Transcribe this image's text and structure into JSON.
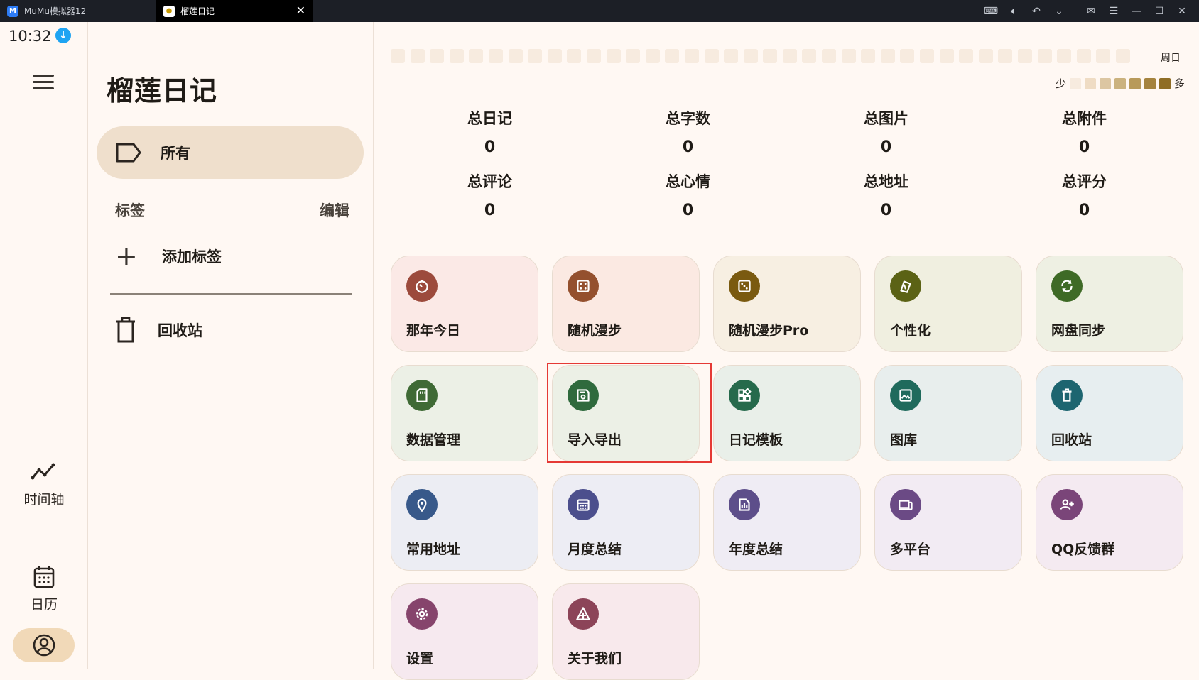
{
  "titlebar": {
    "tabs": [
      {
        "label": "MuMu模拟器12",
        "active": false
      },
      {
        "label": "榴莲日记",
        "active": true
      }
    ]
  },
  "status": {
    "time": "10:32"
  },
  "rail": {
    "items": [
      {
        "label": "时间轴"
      },
      {
        "label": "日历"
      }
    ]
  },
  "drawer": {
    "app_title": "榴莲日记",
    "all_label": "所有",
    "tags_label": "标签",
    "edit_label": "编辑",
    "add_tag_label": "添加标签",
    "trash_label": "回收站"
  },
  "heatmap": {
    "weekday_label": "周日",
    "legend_less": "少",
    "legend_more": "多",
    "legend_colors": [
      "#f7ebdf",
      "#efdcc4",
      "#dcc6a2",
      "#cbb27e",
      "#b89a5a",
      "#a5833e",
      "#8f6d25"
    ]
  },
  "stats": [
    {
      "label": "总日记",
      "value": "0"
    },
    {
      "label": "总字数",
      "value": "0"
    },
    {
      "label": "总图片",
      "value": "0"
    },
    {
      "label": "总附件",
      "value": "0"
    },
    {
      "label": "总评论",
      "value": "0"
    },
    {
      "label": "总心情",
      "value": "0"
    },
    {
      "label": "总地址",
      "value": "0"
    },
    {
      "label": "总评分",
      "value": "0"
    }
  ],
  "features": [
    {
      "label": "那年今日",
      "icon": "timer-icon",
      "bg": "#fbe9e6",
      "iconbg": "#9c4a3c"
    },
    {
      "label": "随机漫步",
      "icon": "dice-icon",
      "bg": "#fbe9e2",
      "iconbg": "#94502e"
    },
    {
      "label": "随机漫步Pro",
      "icon": "dice-pro-icon",
      "bg": "#f7efe2",
      "iconbg": "#7a5a10"
    },
    {
      "label": "个性化",
      "icon": "palette-icon",
      "bg": "#f0efe0",
      "iconbg": "#5b6215"
    },
    {
      "label": "网盘同步",
      "icon": "sync-icon",
      "bg": "#eef0e3",
      "iconbg": "#3e6a26"
    },
    {
      "label": "数据管理",
      "icon": "sd-card-icon",
      "bg": "#ecf0e6",
      "iconbg": "#3f6a35"
    },
    {
      "label": "导入导出",
      "icon": "save-icon",
      "bg": "#ecf0e6",
      "iconbg": "#2f6a3d"
    },
    {
      "label": "日记模板",
      "icon": "widgets-icon",
      "bg": "#e9efe9",
      "iconbg": "#266a4c"
    },
    {
      "label": "图库",
      "icon": "image-icon",
      "bg": "#e8eeed",
      "iconbg": "#1f6a5c"
    },
    {
      "label": "回收站",
      "icon": "trash-icon",
      "bg": "#e7eef0",
      "iconbg": "#1d6570"
    },
    {
      "label": "常用地址",
      "icon": "location-icon",
      "bg": "#ecedf3",
      "iconbg": "#38598a"
    },
    {
      "label": "月度总结",
      "icon": "calendar-month-icon",
      "bg": "#ededf4",
      "iconbg": "#4c4f8d"
    },
    {
      "label": "年度总结",
      "icon": "summary-icon",
      "bg": "#efecf4",
      "iconbg": "#5d4e8a"
    },
    {
      "label": "多平台",
      "icon": "devices-icon",
      "bg": "#f2ebf3",
      "iconbg": "#6b4a85"
    },
    {
      "label": "QQ反馈群",
      "icon": "group-add-icon",
      "bg": "#f4eaf1",
      "iconbg": "#7a4579"
    },
    {
      "label": "设置",
      "icon": "gear-icon",
      "bg": "#f6e9ef",
      "iconbg": "#86446c"
    },
    {
      "label": "关于我们",
      "icon": "about-icon",
      "bg": "#f8e9ec",
      "iconbg": "#8c4458"
    }
  ]
}
